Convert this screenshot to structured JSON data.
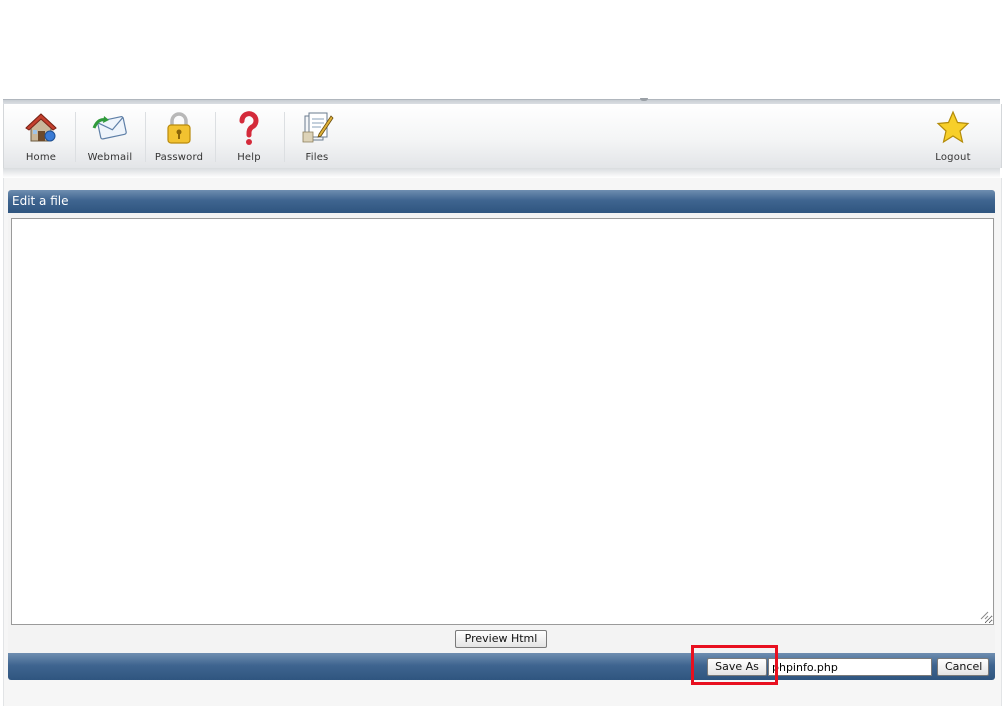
{
  "toolbar": {
    "items": [
      {
        "label": "Home",
        "icon": "home-icon"
      },
      {
        "label": "Webmail",
        "icon": "webmail-icon"
      },
      {
        "label": "Password",
        "icon": "padlock-icon"
      },
      {
        "label": "Help",
        "icon": "question-mark-icon"
      },
      {
        "label": "Files",
        "icon": "files-icon"
      }
    ],
    "logout": {
      "label": "Logout",
      "icon": "star-icon"
    }
  },
  "editor": {
    "title": "Edit a file",
    "content": "",
    "preview_label": "Preview Html",
    "save_as_label": "Save As",
    "filename": "phpinfo.php",
    "cancel_label": "Cancel"
  },
  "colors": {
    "header_bar": "#3f6590",
    "highlight": "#e8101f"
  }
}
